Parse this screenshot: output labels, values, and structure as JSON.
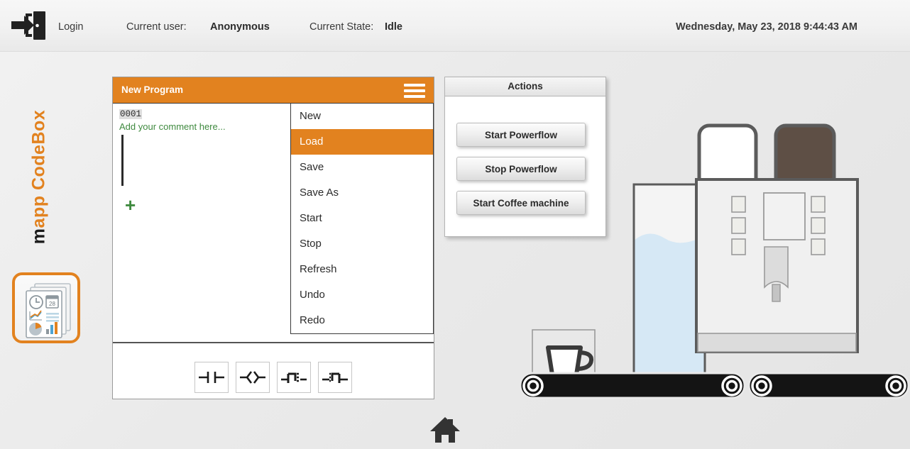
{
  "header": {
    "login_label": "Login",
    "current_user_label": "Current user:",
    "current_user_value": "Anonymous",
    "current_state_label": "Current State:",
    "current_state_value": "Idle",
    "datetime": "Wednesday, May 23, 2018 9:44:43 AM",
    "login_icon": "login-door-arrow-icon"
  },
  "sidebar": {
    "brand_m": "m",
    "brand_rest": "app CodeBox",
    "brand_full": "mapp CodeBox",
    "icon": "documents-reports-icon",
    "accent_color": "#e2821f"
  },
  "program_panel": {
    "title": "New Program",
    "menu_icon": "hamburger-menu-icon",
    "titlebar_color": "#e2821f",
    "editor": {
      "rung_number": "0001",
      "comment": "Add your comment here...",
      "add_rung_glyph": "+"
    },
    "menu": {
      "selected": "Load",
      "items": [
        {
          "label": "New"
        },
        {
          "label": "Load"
        },
        {
          "label": "Save"
        },
        {
          "label": "Save As"
        },
        {
          "label": "Start"
        },
        {
          "label": "Stop"
        },
        {
          "label": "Refresh"
        },
        {
          "label": "Undo"
        },
        {
          "label": "Redo"
        }
      ]
    },
    "toolbar": {
      "tools": [
        {
          "name": "normally-open-contact-icon"
        },
        {
          "name": "output-coil-icon"
        },
        {
          "name": "rising-edge-contact-icon"
        },
        {
          "name": "falling-edge-contact-icon"
        }
      ]
    }
  },
  "actions": {
    "header": "Actions",
    "buttons": [
      {
        "label": "Start Powerflow"
      },
      {
        "label": "Stop Powerflow"
      },
      {
        "label": "Start Coffee machine"
      }
    ]
  },
  "scene": {
    "name": "coffee-machine-conveyor-illustration",
    "cup": "coffee-cup-icon",
    "water_tank": "water-tank",
    "milk_hopper": "milk-container",
    "bean_hopper": "coffee-bean-container",
    "conveyor": "conveyor-belt",
    "colors": {
      "water": "#d6e8f5",
      "beans": "#5e4f45",
      "machine_body": "#f0f0f0",
      "belt": "#1a1a1a"
    }
  },
  "footer": {
    "home_icon": "home-icon"
  }
}
